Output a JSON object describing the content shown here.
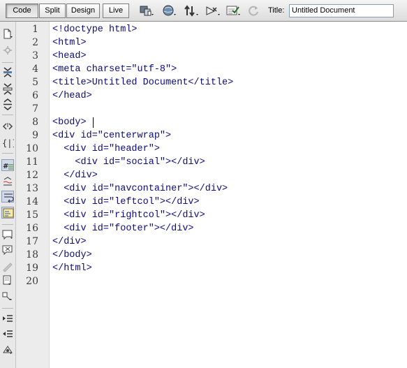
{
  "toolbar": {
    "views": [
      {
        "label": "Code",
        "active": true
      },
      {
        "label": "Split",
        "active": false
      },
      {
        "label": "Design",
        "active": false
      },
      {
        "label": "Live",
        "active": false
      }
    ],
    "icons": [
      "multiscreen-icon",
      "preview-browser-icon",
      "file-management-icon",
      "visual-aids-icon",
      "validate-markup-icon",
      "refresh-icon"
    ],
    "title_label": "Title:",
    "title_value": "Untitled Document"
  },
  "left_toolbar": {
    "icons": [
      "open-documents-icon",
      "show-code-navigator-icon",
      "collapse-full-tag-icon",
      "collapse-selection-icon",
      "expand-all-icon",
      "select-parent-tag-icon",
      "balance-braces-icon",
      "line-numbers-icon",
      "highlight-invalid-code-icon",
      "word-wrap-icon",
      "syntax-coloring-icon",
      "apply-comment-icon",
      "remove-comment-icon",
      "wrap-tag-icon",
      "recent-snippets-icon",
      "move-css-icon",
      "indent-code-icon",
      "outdent-code-icon",
      "format-source-code-icon"
    ]
  },
  "editor": {
    "line_numbers": [
      "1",
      "2",
      "3",
      "4",
      "5",
      "6",
      "7",
      "8",
      "9",
      "10",
      "11",
      "12",
      "13",
      "14",
      "15",
      "16",
      "17",
      "18",
      "19",
      "20"
    ],
    "lines": [
      "<!doctype html>",
      "<html>",
      "<head>",
      "<meta charset=\"utf-8\">",
      "<title>Untitled Document</title>",
      "</head>",
      "",
      "<body>",
      "<div id=\"centerwrap\">",
      "  <div id=\"header\">",
      "    <div id=\"social\"></div>",
      "  </div>",
      "  <div id=\"navcontainer\"></div>",
      "  <div id=\"leftcol\"></div>",
      "  <div id=\"rightcol\"></div>",
      "  <div id=\"footer\"></div>",
      "</div>",
      "</body>",
      "</html>",
      ""
    ],
    "cursor_line": 8,
    "code_color": "#0b0b80"
  }
}
